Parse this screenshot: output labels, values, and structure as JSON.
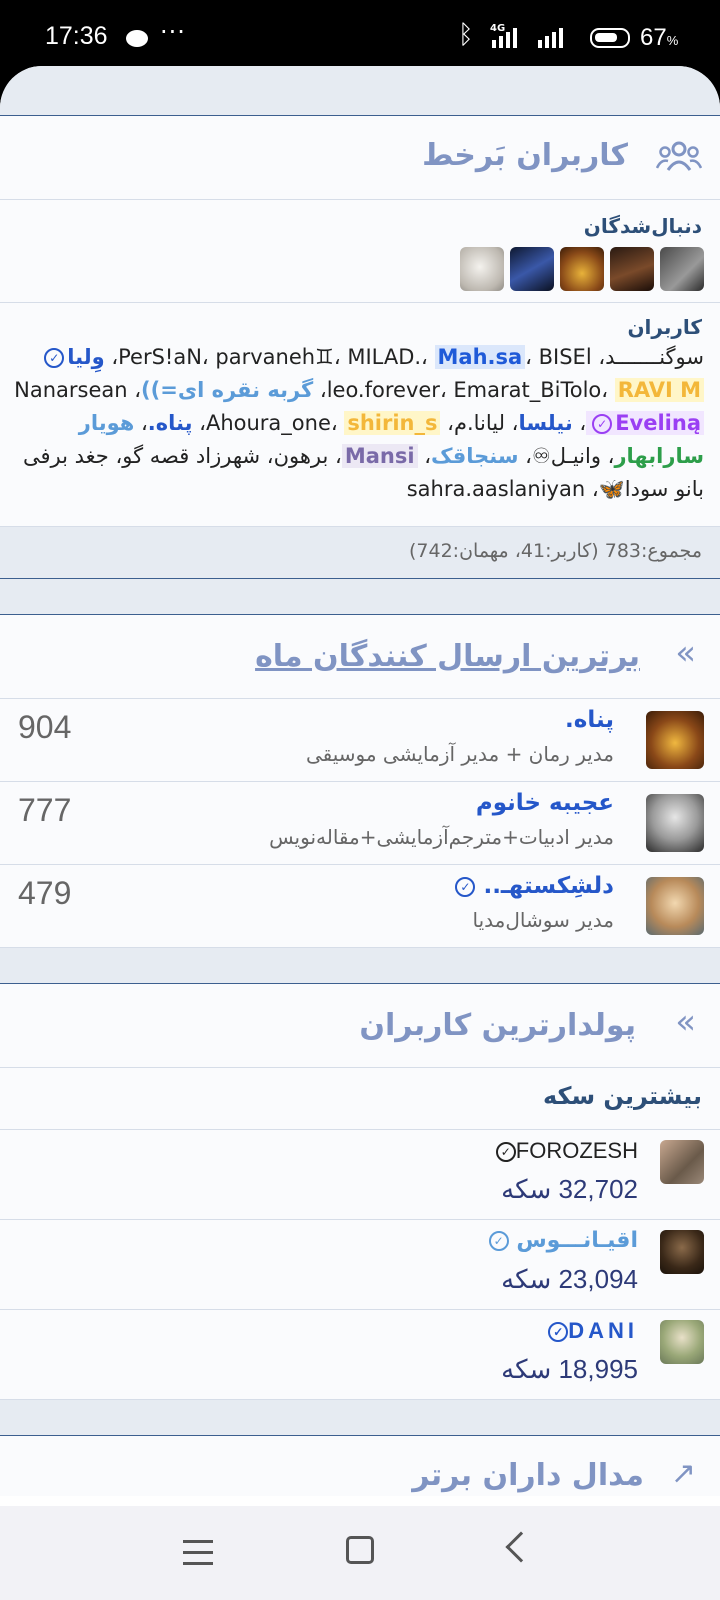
{
  "status_bar": {
    "time": "17:36",
    "network": "4G",
    "battery": "67",
    "battery_unit": "%"
  },
  "online": {
    "title": "کاربران بَرخط",
    "followed_title": "دنبال‌شدگان",
    "users_title": "کاربران",
    "users_lines": [
      [
        {
          "t": "سوگنـــــــد",
          "c": ""
        },
        {
          "t": "، ",
          "c": ""
        },
        {
          "t": "PerS!aN",
          "c": ""
        },
        {
          "t": "، ",
          "c": ""
        },
        {
          "t": "parvaneh♊",
          "c": ""
        },
        {
          "t": "، ",
          "c": ""
        },
        {
          "t": "MILAD.",
          "c": ""
        },
        {
          "t": "، ",
          "c": ""
        },
        {
          "t": "Mah.sa",
          "c": "n-mbox"
        },
        {
          "t": "، ",
          "c": ""
        },
        {
          "t": "BISEl",
          "c": ""
        },
        {
          "t": "، ",
          "c": ""
        },
        {
          "t": "وِلیا",
          "c": "n-blue",
          "v": true
        }
      ],
      [
        {
          "t": "leo.forever",
          "c": ""
        },
        {
          "t": "، ",
          "c": ""
        },
        {
          "t": "Emarat_BiTolo",
          "c": ""
        },
        {
          "t": "، ",
          "c": ""
        },
        {
          "t": "RAVI M",
          "c": "n-yel"
        },
        {
          "t": "، ",
          "c": ""
        },
        {
          "t": "گربه نقره ای=))",
          "c": "n-light"
        },
        {
          "t": "، ",
          "c": ""
        },
        {
          "t": "Nanarsean",
          "c": ""
        }
      ],
      [
        {
          "t": "Eveliną",
          "c": "n-purple",
          "v": true
        },
        {
          "t": "، ",
          "c": ""
        },
        {
          "t": "نیلسا",
          "c": "n-blue"
        },
        {
          "t": "، ",
          "c": ""
        },
        {
          "t": "لیانا.م",
          "c": ""
        },
        {
          "t": "، ",
          "c": ""
        },
        {
          "t": "Ahoura_one",
          "c": ""
        },
        {
          "t": "، ",
          "c": ""
        },
        {
          "t": "shirin_s",
          "c": "n-yel"
        },
        {
          "t": "، ",
          "c": ""
        },
        {
          "t": "پناه.",
          "c": "n-blue"
        },
        {
          "t": "، ",
          "c": ""
        },
        {
          "t": "هویار",
          "c": "n-light"
        }
      ],
      [
        {
          "t": "سارابهار",
          "c": "n-green"
        },
        {
          "t": "، ",
          "c": ""
        },
        {
          "t": "وانیـل♾",
          "c": ""
        },
        {
          "t": "، ",
          "c": ""
        },
        {
          "t": "سنجاقک",
          "c": "n-light"
        },
        {
          "t": "، ",
          "c": ""
        },
        {
          "t": "Mansi",
          "c": "n-mansi"
        },
        {
          "t": "، ",
          "c": ""
        },
        {
          "t": "برهون",
          "c": ""
        },
        {
          "t": "، ",
          "c": ""
        },
        {
          "t": "شهرزاد قصه گو",
          "c": ""
        },
        {
          "t": "، ",
          "c": ""
        },
        {
          "t": "جغد برفی",
          "c": ""
        }
      ],
      [
        {
          "t": "بانو سودا🦋",
          "c": ""
        },
        {
          "t": "، ",
          "c": ""
        },
        {
          "t": "sahra.aaslaniyan",
          "c": ""
        }
      ]
    ],
    "total": "مجموع:783 (کاربر:41، مهمان:742)"
  },
  "top_posters": {
    "title": "برترین ارسال کنندگان ماه",
    "items": [
      {
        "name": "پناه.",
        "role": "مدیر رمان + مدیر آزمایشی موسیقی",
        "count": "904"
      },
      {
        "name": "عجیبه خانوم",
        "role": "مدیر ادبیات+مترجم‌آزمایشی+مقاله‌نویس",
        "count": "777"
      },
      {
        "name": "دلشِکستهـ..",
        "role": "مدیر سوشال‌مدیا",
        "count": "479"
      }
    ]
  },
  "richest": {
    "title": "پولدارترین کاربران",
    "subtitle": "بیشترین سکه",
    "items": [
      {
        "name": "FOROZESH",
        "coins": "32,702 سکه"
      },
      {
        "name": "اقیـانـــوس",
        "coins": "23,094 سکه"
      },
      {
        "name": "DANI",
        "coins": "18,995 سکه"
      }
    ]
  },
  "next_title": "مدال داران برتر",
  "colors": {
    "accent": "#8094c3",
    "name_blue": "#2557c9",
    "divider": "#3c5f8f"
  }
}
